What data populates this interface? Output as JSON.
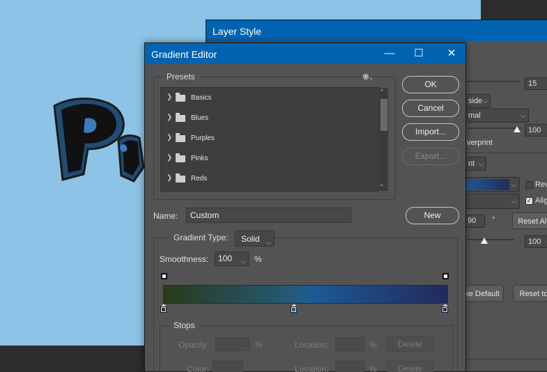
{
  "colors": {
    "canvas_bg": "#8dc3e6",
    "titlebar": "#0063b1",
    "dialog_bg": "#535353",
    "gradient_stops": [
      "#2a3a1a",
      "#1c5a96",
      "#232a5c"
    ]
  },
  "layer_style": {
    "title": "Layer Style",
    "size_value": "15",
    "position_value": "side",
    "blend_value": "mal",
    "opacity_value": "100",
    "overprint_label": "verprint",
    "fill_type_value": "nt",
    "reverse_label": "Rev",
    "align_label": "Alig",
    "angle_value": "90",
    "degree_symbol": "°",
    "reset_align_label": "Reset Ali",
    "scale_value": "100",
    "make_default_label": "ke Default",
    "reset_default_label": "Reset to"
  },
  "gradient_editor": {
    "title": "Gradient Editor",
    "window_controls": {
      "minimize": "—",
      "maximize": "☐",
      "close": "✕"
    },
    "presets": {
      "label": "Presets",
      "gear_icon": "gear-icon",
      "items": [
        {
          "label": "Basics"
        },
        {
          "label": "Blues"
        },
        {
          "label": "Purples"
        },
        {
          "label": "Pinks"
        },
        {
          "label": "Reds"
        }
      ]
    },
    "buttons": {
      "ok": "OK",
      "cancel": "Cancel",
      "import": "Import...",
      "export": "Export...",
      "new": "New"
    },
    "name_label": "Name:",
    "name_value": "Custom",
    "gradient_type_label": "Gradient Type:",
    "gradient_type_value": "Solid",
    "smoothness_label": "Smoothness:",
    "smoothness_value": "100",
    "percent": "%",
    "stops": {
      "label": "Stops",
      "opacity_label": "Opacity:",
      "opacity_unit": "%",
      "location_label": "Location:",
      "location_unit": "%",
      "delete_label": "Delete",
      "color_label": "Color:"
    }
  }
}
